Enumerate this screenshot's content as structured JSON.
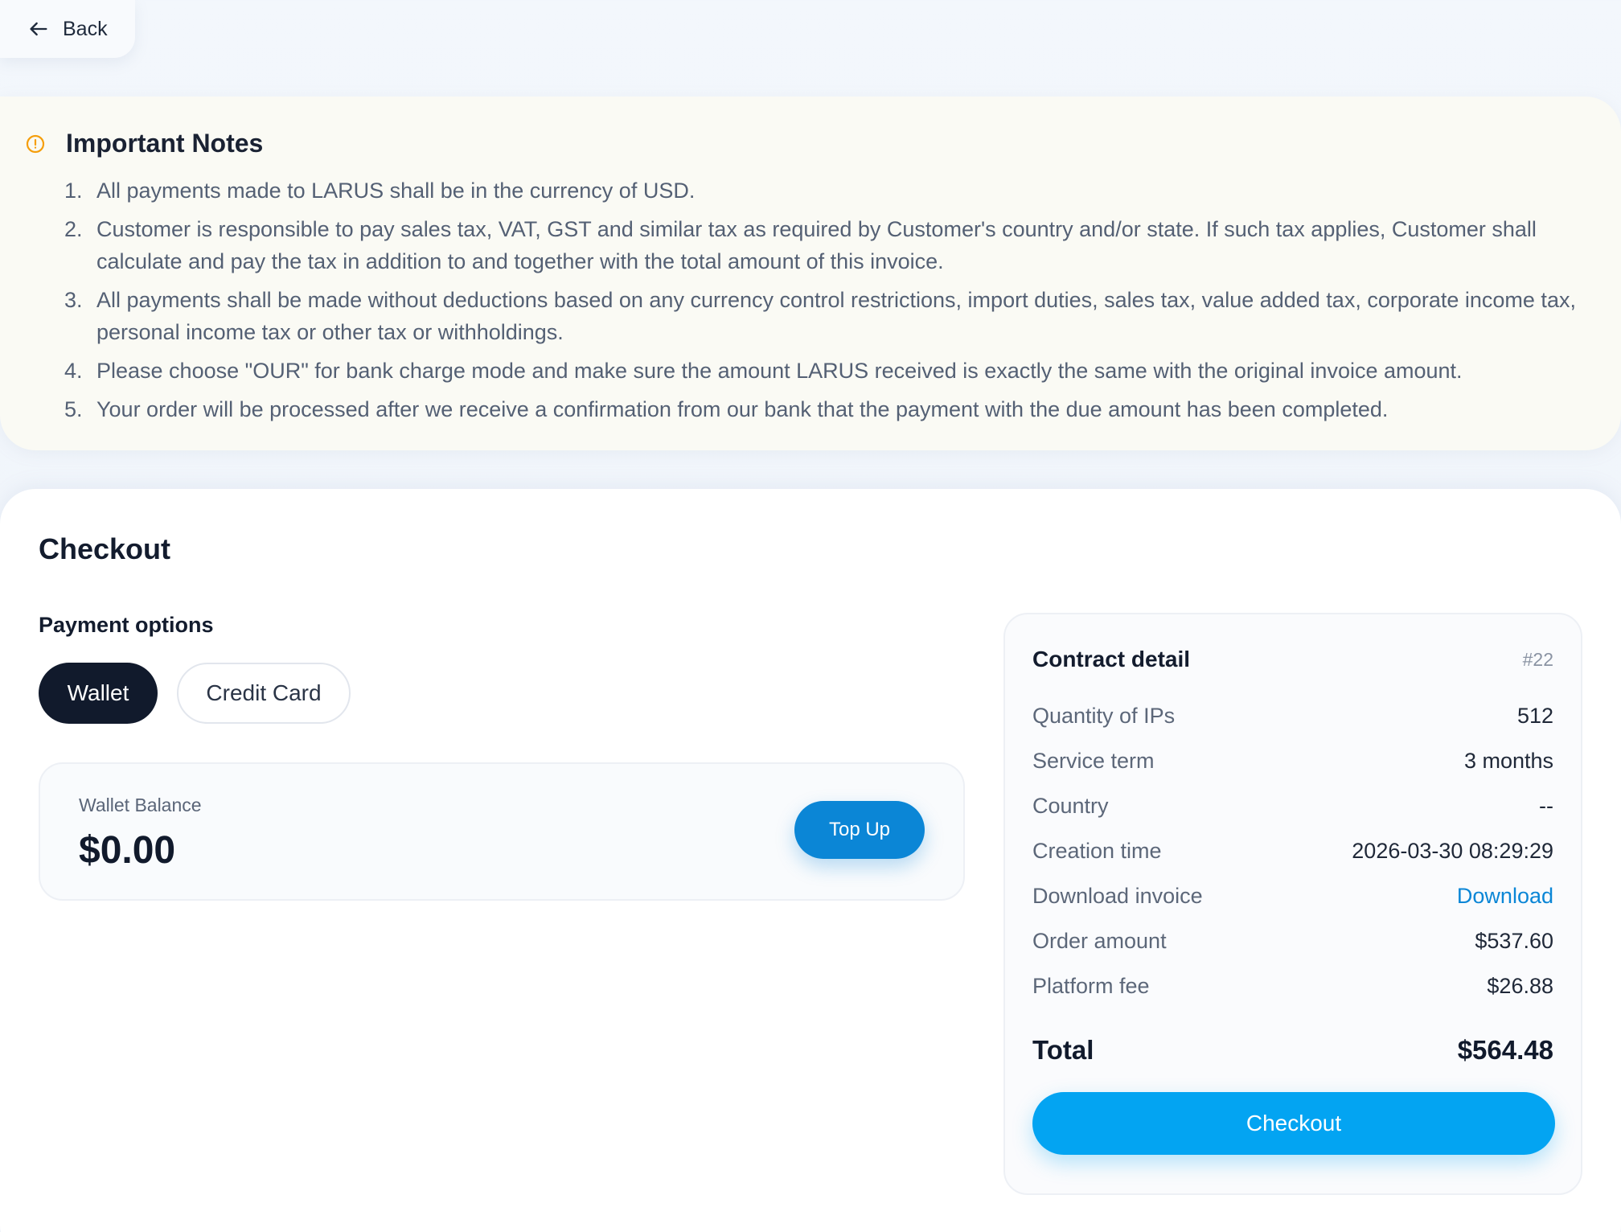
{
  "header": {
    "back_label": "Back",
    "back_icon": "arrow-left-icon"
  },
  "notes": {
    "icon": "alert-circle-icon",
    "icon_color": "#f59e0b",
    "title": "Important Notes",
    "items": [
      {
        "num": "1.",
        "text": "All payments made to LARUS shall be in the currency of USD."
      },
      {
        "num": "2.",
        "text": "Customer is responsible to pay sales tax, VAT, GST and similar tax as required by Customer's country and/or state. If such tax applies, Customer shall calculate and pay the tax in addition to and together with the total amount of this invoice."
      },
      {
        "num": "3.",
        "text": "All payments shall be made without deductions based on any currency control restrictions, import duties, sales tax, value added tax, corporate income tax, personal income tax or other tax or withholdings."
      },
      {
        "num": "4.",
        "text": "Please choose \"OUR\" for bank charge mode and make sure the amount LARUS received is exactly the same with the original invoice amount."
      },
      {
        "num": "5.",
        "text": "Your order will be processed after we receive a confirmation from our bank that the payment with the due amount has been completed."
      }
    ]
  },
  "checkout": {
    "title": "Checkout",
    "payment_options_label": "Payment options",
    "options": [
      {
        "label": "Wallet",
        "selected": true
      },
      {
        "label": "Credit Card",
        "selected": false
      }
    ],
    "wallet": {
      "balance_label": "Wallet Balance",
      "balance": "$0.00",
      "topup_label": "Top Up"
    }
  },
  "contract": {
    "title": "Contract detail",
    "id": "#22",
    "rows": [
      {
        "label": "Quantity of IPs",
        "value": "512"
      },
      {
        "label": "Service term",
        "value": "3 months"
      },
      {
        "label": "Country",
        "value": "--"
      },
      {
        "label": "Creation time",
        "value": "2026-03-30 08:29:29"
      },
      {
        "label": "Download invoice",
        "value": "Download"
      },
      {
        "label": "Order amount",
        "value": "$537.60"
      },
      {
        "label": "Platform fee",
        "value": "$26.88"
      }
    ],
    "total_label": "Total",
    "total_value": "$564.48",
    "checkout_label": "Checkout"
  },
  "colors": {
    "accent": "#03a4f2",
    "link": "#0b86d6",
    "dark": "#111a2c"
  }
}
